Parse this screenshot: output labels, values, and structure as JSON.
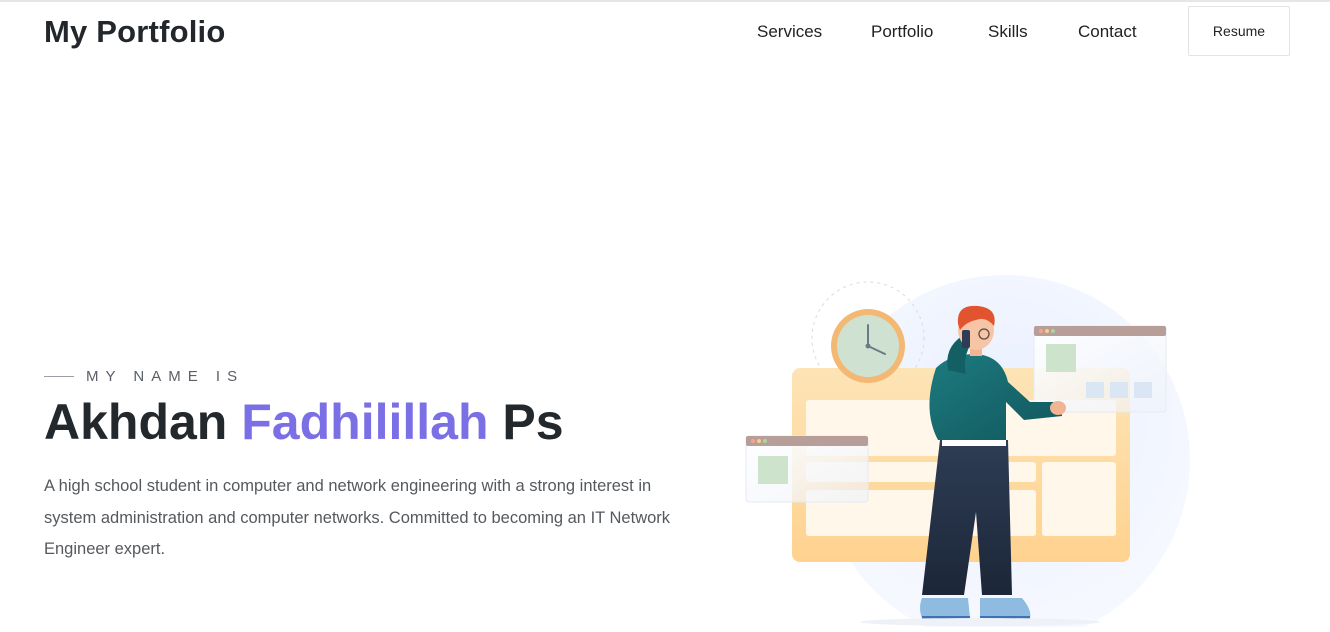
{
  "header": {
    "brand": "My Portfolio",
    "nav": [
      {
        "label": "Services"
      },
      {
        "label": "Portfolio"
      },
      {
        "label": "Skills"
      },
      {
        "label": "Contact"
      }
    ],
    "resume_label": "Resume"
  },
  "hero": {
    "eyebrow": "MY NAME IS",
    "name_part1": "Akhdan",
    "name_accent": "Fadhilillah",
    "name_part2": "Ps",
    "description": "A high school student in computer and network engineering with a strong interest in system administration and computer networks. Committed to becoming an IT Network Engineer expert.",
    "accent_color": "#7b6fe6"
  },
  "illustration": {
    "icon": "person-on-phone-illustration"
  }
}
